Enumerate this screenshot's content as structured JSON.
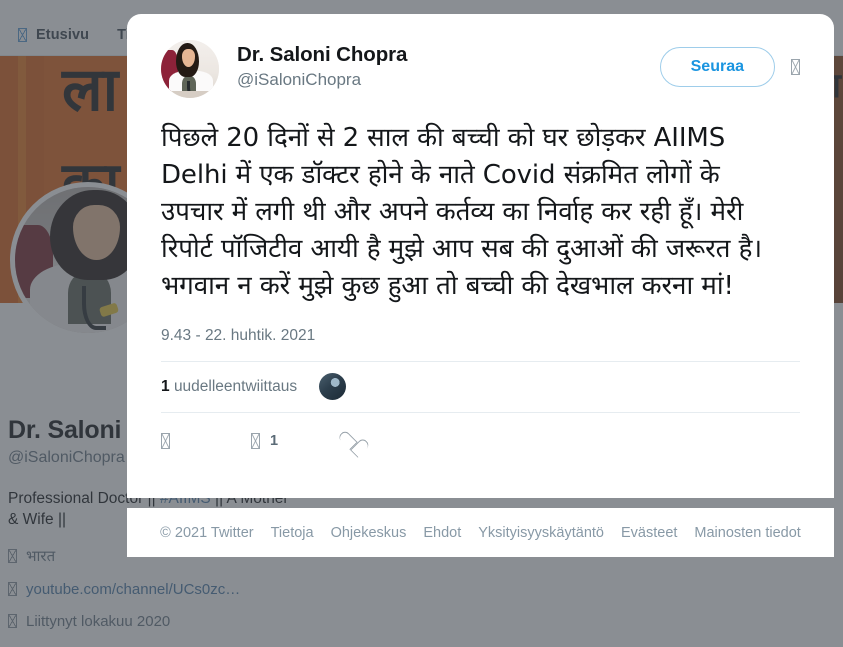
{
  "nav": {
    "items": [
      {
        "label": "Etusivu",
        "icon": "home-icon"
      },
      {
        "label": "Ti",
        "icon": "search-icon"
      }
    ],
    "right_partial": "in"
  },
  "banner": {
    "line1": "ला",
    "line2": "का",
    "right_glyph": "भा"
  },
  "profile": {
    "name": "Dr. Saloni Ch",
    "handle": "@iSaloniChopra",
    "bio_part1": "Professional Doctor || ",
    "bio_hashtag": "#AIIMS",
    "bio_part2": " || A Mother & Wife ||",
    "location": "भारत",
    "location_icon": "location-icon",
    "website": "youtube.com/channel/UCs0zc…",
    "website_icon": "link-icon",
    "joined": "Liittynyt lokakuu 2020",
    "joined_icon": "calendar-icon"
  },
  "tweet": {
    "author_name": "Dr. Saloni Chopra",
    "author_handle": "@iSaloniChopra",
    "avatar_icon": "author-avatar",
    "follow_label": "Seuraa",
    "more_icon": "more-options-icon",
    "text": "पिछले 20 दिनों से 2 साल की बच्ची को घर छोड़कर AIIMS Delhi में एक डॉक्टर होने के नाते Covid संक्रमित लोगों के उपचार में लगी थी और अपने कर्तव्य का निर्वाह कर रही हूँ। मेरी रिपोर्ट पॉजिटीव आयी है मुझे आप सब की दुआओं की जरूरत है।भगवान न करें मुझे कुछ हुआ तो बच्ची की देखभाल करना मां!",
    "timestamp": "9.43 - 22. huhtik. 2021",
    "retweet_count": "1",
    "retweet_label": "uudelleentwiittaus",
    "retweeter_avatar_icon": "retweeter-avatar",
    "actions": {
      "reply_icon": "reply-icon",
      "retweet_icon": "retweet-icon",
      "retweet_value": "1",
      "like_icon": "heart-icon"
    }
  },
  "footer": {
    "copyright": "© 2021 Twitter",
    "links": [
      "Tietoja",
      "Ohjekeskus",
      "Ehdot",
      "Yksityisyyskäytäntö",
      "Evästeet",
      "Mainosten tiedot"
    ]
  },
  "colors": {
    "twitter_blue": "#1b95e0",
    "banner_orange": "#e06418",
    "overlay": "#424950",
    "muted_text": "#697882"
  }
}
